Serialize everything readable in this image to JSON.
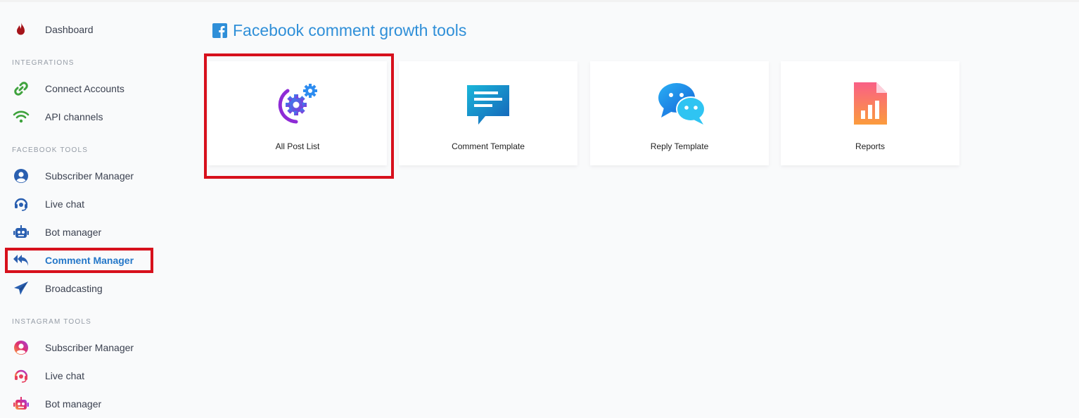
{
  "sidebar": {
    "dashboard": "Dashboard",
    "sections": {
      "integrations": "INTEGRATIONS",
      "facebook_tools": "FACEBOOK TOOLS",
      "instagram_tools": "INSTAGRAM TOOLS"
    },
    "integrations": [
      {
        "label": "Connect Accounts",
        "icon": "link-icon"
      },
      {
        "label": "API channels",
        "icon": "wifi-icon"
      }
    ],
    "facebook_tools": [
      {
        "label": "Subscriber Manager",
        "icon": "user-circle-icon"
      },
      {
        "label": "Live chat",
        "icon": "headset-icon"
      },
      {
        "label": "Bot manager",
        "icon": "robot-icon"
      },
      {
        "label": "Comment Manager",
        "icon": "reply-all-icon",
        "active": true
      },
      {
        "label": "Broadcasting",
        "icon": "paper-plane-icon"
      }
    ],
    "instagram_tools": [
      {
        "label": "Subscriber Manager",
        "icon": "user-circle-icon"
      },
      {
        "label": "Live chat",
        "icon": "headset-icon"
      },
      {
        "label": "Bot manager",
        "icon": "robot-icon"
      }
    ]
  },
  "main": {
    "title": "Facebook comment growth tools",
    "cards": [
      {
        "label": "All Post List",
        "icon": "gears-icon"
      },
      {
        "label": "Comment Template",
        "icon": "message-icon"
      },
      {
        "label": "Reply Template",
        "icon": "chat-bubbles-icon"
      },
      {
        "label": "Reports",
        "icon": "report-icon"
      }
    ]
  },
  "colors": {
    "accent": "#2477c8",
    "highlight": "#d7101c",
    "facebook": "#2f8fd8"
  }
}
